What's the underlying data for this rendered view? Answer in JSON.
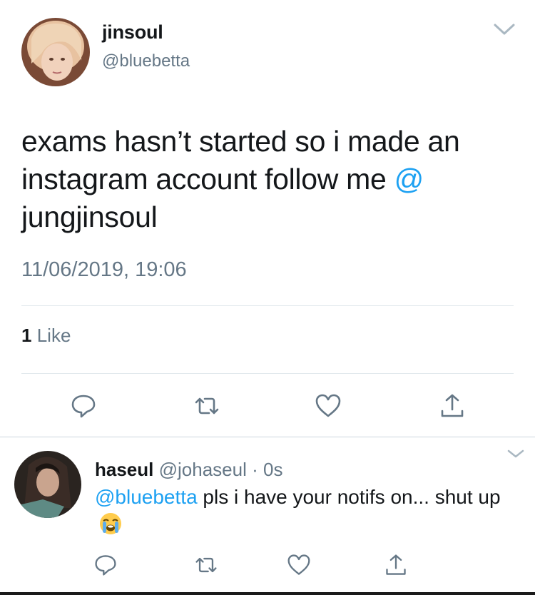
{
  "tweet": {
    "author": {
      "name": "jinsoul",
      "handle": "@bluebetta"
    },
    "text_before_mention": "exams hasn’t started so i made an instagram account follow me ",
    "mention": "@",
    "text_after_mention": "jungjinsoul",
    "timestamp": "11/06/2019, 19:06",
    "likes_count": "1",
    "likes_label": "Like",
    "actions": [
      "reply-icon",
      "retweet-icon",
      "like-icon",
      "share-icon"
    ]
  },
  "reply": {
    "author": {
      "name": "haseul",
      "handle": "@johaseul",
      "separator": "·",
      "time": "0s"
    },
    "mention": "@bluebetta",
    "text": " pls i have your notifs on... shut up",
    "emoji": "loudly-crying-face-emoji",
    "actions": [
      "reply-icon",
      "retweet-icon",
      "like-icon",
      "share-icon"
    ]
  },
  "colors": {
    "accent": "#1da1f2",
    "muted": "#657786",
    "text": "#14171a",
    "divider": "#e1e8ed"
  }
}
